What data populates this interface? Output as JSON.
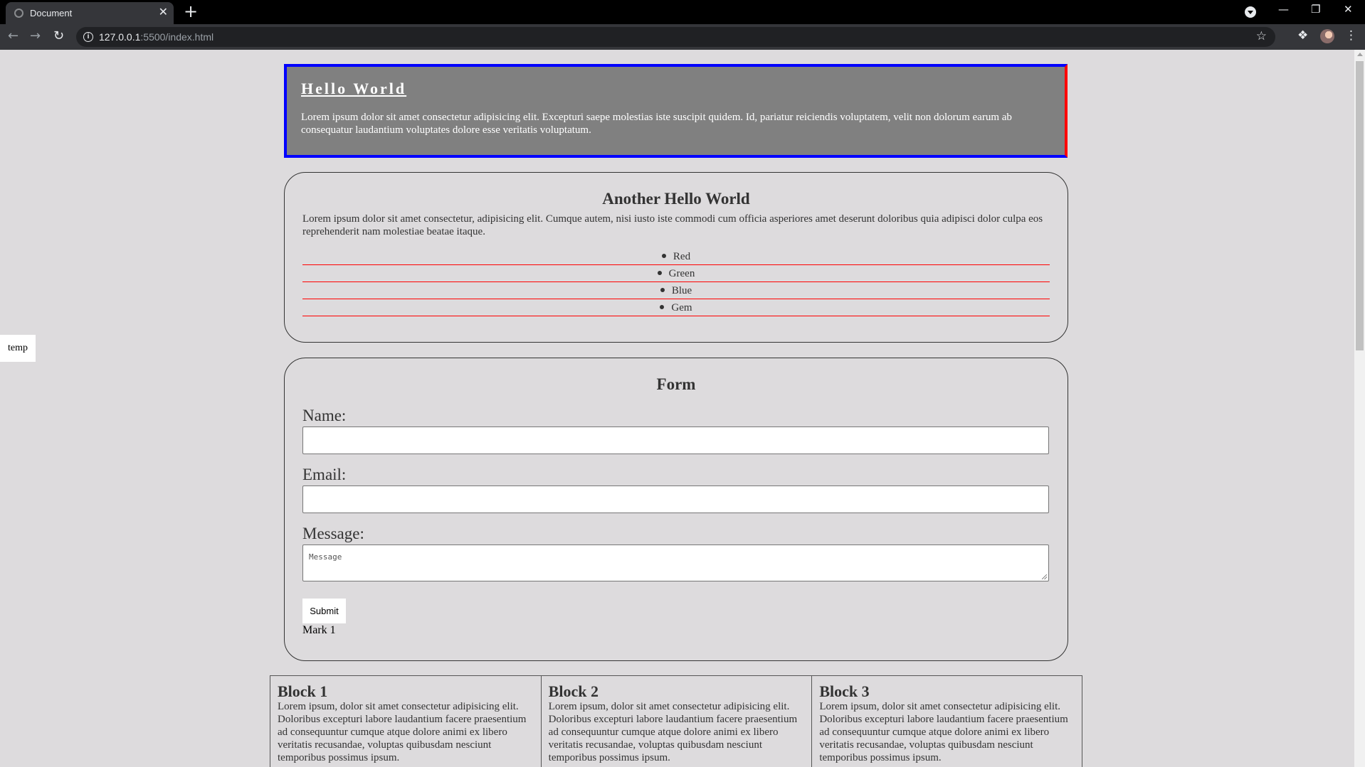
{
  "browser": {
    "tab_title": "Document",
    "new_tab": "+",
    "url_host": "127.0.0.1",
    "url_path": ":5500/index.html",
    "close_glyph": "✕",
    "minimize_glyph": "—",
    "restore_glyph": "❐",
    "window_close_glyph": "✕"
  },
  "page": {
    "temp_label": "temp",
    "hero": {
      "title": "Hello World",
      "text": "Lorem ipsum dolor sit amet consectetur adipisicing elit. Excepturi saepe molestias iste suscipit quidem. Id, pariatur reiciendis voluptatem, velit non dolorum earum ab consequatur laudantium voluptates dolore esse veritatis voluptatum."
    },
    "card1": {
      "title": "Another Hello World",
      "text": "Lorem ipsum dolor sit amet consectetur, adipisicing elit. Cumque autem, nisi iusto iste commodi cum officia asperiores amet deserunt doloribus quia adipisci dolor culpa eos reprehenderit nam molestiae beatae itaque.",
      "items": [
        "Red",
        "Green",
        "Blue",
        "Gem"
      ]
    },
    "form": {
      "title": "Form",
      "name_label": "Name:",
      "email_label": "Email:",
      "message_label": "Message:",
      "message_placeholder": "Message",
      "submit_label": "Submit",
      "mark": "Mark 1"
    },
    "blocks": [
      {
        "title": "Block 1",
        "text": "Lorem ipsum, dolor sit amet consectetur adipisicing elit. Doloribus excepturi labore laudantium facere praesentium ad consequuntur cumque atque dolore animi ex libero veritatis recusandae, voluptas quibusdam nesciunt temporibus possimus ipsum."
      },
      {
        "title": "Block 2",
        "text": "Lorem ipsum, dolor sit amet consectetur adipisicing elit. Doloribus excepturi labore laudantium facere praesentium ad consequuntur cumque atque dolore animi ex libero veritatis recusandae, voluptas quibusdam nesciunt temporibus possimus ipsum."
      },
      {
        "title": "Block 3",
        "text": "Lorem ipsum, dolor sit amet consectetur adipisicing elit. Doloribus excepturi labore laudantium facere praesentium ad consequuntur cumque atque dolore animi ex libero veritatis recusandae, voluptas quibusdam nesciunt temporibus possimus ipsum."
      }
    ]
  },
  "colors": {
    "hero_bg": "#808080",
    "hero_border": "#0000ff",
    "hero_border_right": "#ff0000",
    "list_divider": "#ff0000",
    "page_bg": "#dddbdd"
  }
}
